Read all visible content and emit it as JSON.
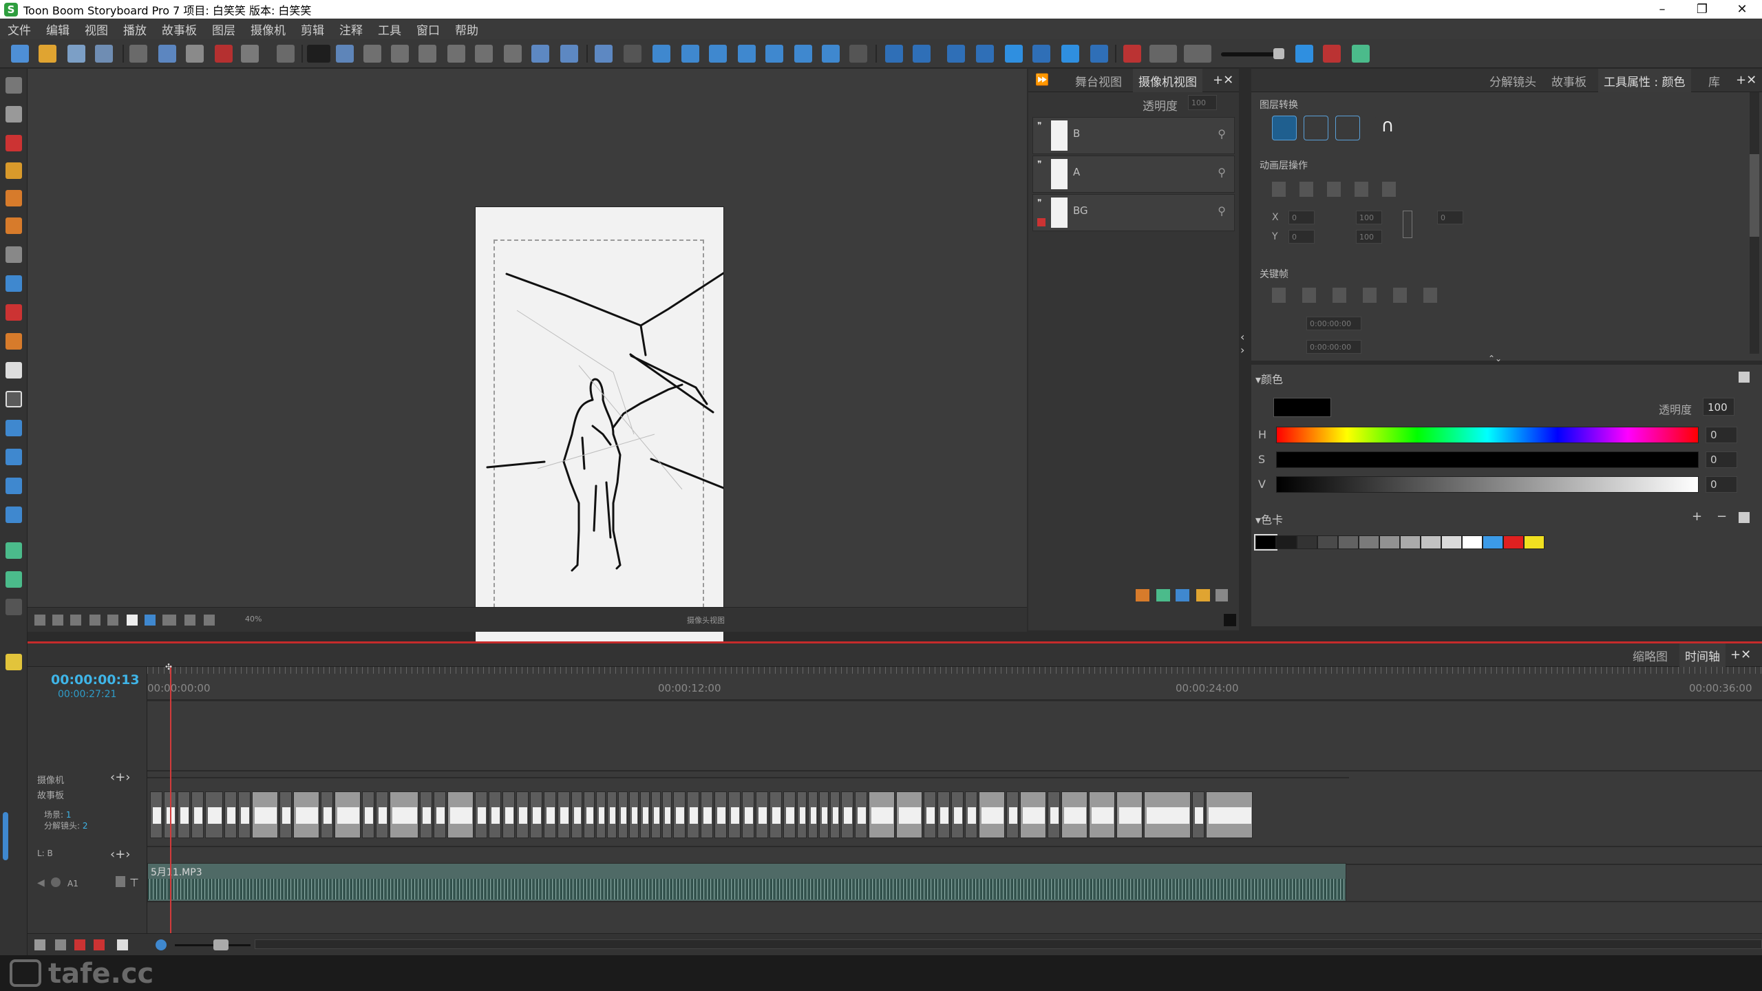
{
  "window": {
    "title": "Toon Boom Storyboard Pro 7 项目: 白笑笑 版本: 白笑笑",
    "controls": [
      "–",
      "❐",
      "✕"
    ]
  },
  "menu": [
    "文件",
    "编辑",
    "视图",
    "播放",
    "故事板",
    "图层",
    "摄像机",
    "剪辑",
    "注释",
    "工具",
    "窗口",
    "帮助"
  ],
  "stage": {
    "zoom": "40%",
    "status": "摄像头视图"
  },
  "layers_panel": {
    "tabs": [
      "舞台视图",
      "摄像机视图"
    ],
    "opacity_label": "透明度",
    "opacity_value": "100",
    "layers": [
      {
        "name": "B"
      },
      {
        "name": "A"
      },
      {
        "name": "BG"
      }
    ]
  },
  "right_panel": {
    "tabs": [
      "分解镜头",
      "故事板",
      "工具属性 : 颜色",
      "库"
    ],
    "layer_transform": "图层转换",
    "anim_ops": "动画层操作",
    "keyframes": "关键帧",
    "fields": {
      "x": "0",
      "y": "0",
      "w": "100",
      "h": "100",
      "angle": "0"
    },
    "time1": "0:00:00:00",
    "time2": "0:00:00:00",
    "color_section": "颜色",
    "color_opacity_label": "透明度",
    "color_opacity": "100",
    "hsv": {
      "h_label": "H",
      "s_label": "S",
      "v_label": "V",
      "h": "0",
      "s": "0",
      "v": "0"
    },
    "swatch_section": "色卡",
    "current_color": "#000000",
    "swatches": [
      "#000000",
      "#1c1c1c",
      "#333333",
      "#4a4a4a",
      "#626262",
      "#7a7a7a",
      "#929292",
      "#aaaaaa",
      "#c2c2c2",
      "#dadada",
      "#ffffff",
      "#3c9be8",
      "#e02020",
      "#f0e020"
    ]
  },
  "timeline": {
    "tabs": [
      "缩略图",
      "时间轴"
    ],
    "current_time": "00:00:00:13",
    "total_time": "00:00:27:21",
    "ruler": [
      "00:00:00:00",
      "00:00:12:00",
      "00:00:24:00",
      "00:00:36:00"
    ],
    "tracks": {
      "camera": "摄像机",
      "storyboard": "故事板",
      "scene_label": "场景:",
      "scene_value": "1",
      "panel_label": "分解镜头:",
      "panel_value": "2",
      "layer_label": "L: B",
      "audio_track": "A1",
      "audio_clip": "5月11.MP3"
    }
  },
  "watermark": "tafe.cc"
}
